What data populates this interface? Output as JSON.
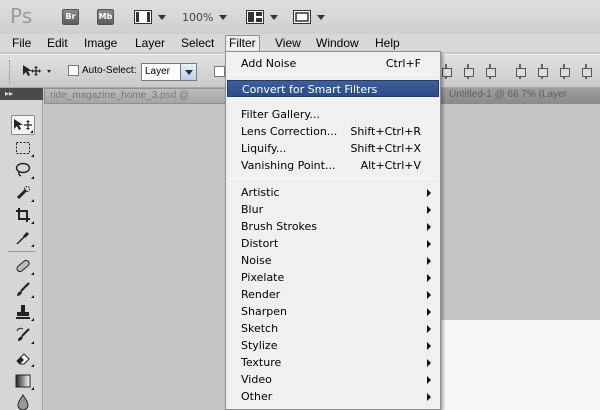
{
  "app": {
    "logo": "Ps",
    "bridge_label": "Br",
    "minibridge_label": "Mb",
    "zoom": "100%"
  },
  "menubar": [
    "File",
    "Edit",
    "Image",
    "Layer",
    "Select",
    "Filter",
    "View",
    "Window",
    "Help"
  ],
  "options": {
    "auto_select_label": "Auto-Select:",
    "auto_select_value": "Layer"
  },
  "documents": {
    "tab1": "ride_magazine_home_3.psd @",
    "tab2": "Untitled-1 @ 66.7% (Layer"
  },
  "filter_menu": {
    "last_filter": {
      "label": "Add Noise",
      "shortcut": "Ctrl+F"
    },
    "convert": "Convert for Smart Filters",
    "gallery_items": [
      {
        "label": "Filter Gallery...",
        "shortcut": ""
      },
      {
        "label": "Lens Correction...",
        "shortcut": "Shift+Ctrl+R"
      },
      {
        "label": "Liquify...",
        "shortcut": "Shift+Ctrl+X"
      },
      {
        "label": "Vanishing Point...",
        "shortcut": "Alt+Ctrl+V"
      }
    ],
    "submenus": [
      "Artistic",
      "Blur",
      "Brush Strokes",
      "Distort",
      "Noise",
      "Pixelate",
      "Render",
      "Sharpen",
      "Sketch",
      "Stylize",
      "Texture",
      "Video",
      "Other"
    ]
  },
  "colors": {
    "highlight": "#2f4f8c",
    "menu_bg": "#f0f0f0",
    "chrome": "#d6d6d6"
  },
  "icons": {
    "tools": [
      "move-tool-icon",
      "marquee-tool-icon",
      "lasso-tool-icon",
      "quick-selection-tool-icon",
      "crop-tool-icon",
      "eyedropper-tool-icon",
      "healing-brush-tool-icon",
      "brush-tool-icon",
      "clone-stamp-tool-icon",
      "history-brush-tool-icon",
      "eraser-tool-icon",
      "gradient-tool-icon",
      "blur-tool-icon"
    ]
  }
}
